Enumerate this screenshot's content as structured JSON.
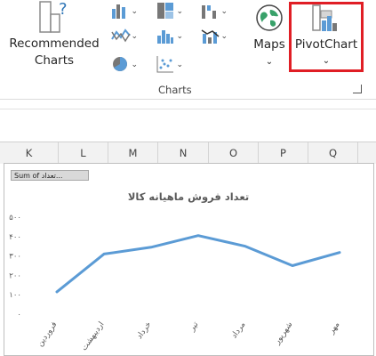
{
  "ribbon": {
    "recommended_charts_line1": "Recommended",
    "recommended_charts_line2": "Charts",
    "maps_label": "Maps",
    "pivotchart_label": "PivotChart",
    "group_label": "Charts",
    "highlight_color": "#e01e25"
  },
  "columns": [
    "K",
    "L",
    "M",
    "N",
    "O",
    "P",
    "Q"
  ],
  "field_button": "Sum of تعداد...",
  "chart_data": {
    "type": "line",
    "title": "تعداد فروش ماهیانه کالا",
    "categories": [
      "فروردین",
      "اردیبهشت",
      "خرداد",
      "تیر",
      "مرداد",
      "شهریور",
      "مهر"
    ],
    "series": [
      {
        "values": [
          115,
          310,
          345,
          405,
          350,
          250,
          318
        ],
        "color": "#5b9bd5"
      }
    ],
    "y_ticks": [
      "۰",
      "۱۰۰",
      "۲۰۰",
      "۳۰۰",
      "۴۰۰",
      "۵۰۰"
    ],
    "ylim": [
      0,
      500
    ],
    "xlabel": "",
    "ylabel": "",
    "grid": false
  }
}
